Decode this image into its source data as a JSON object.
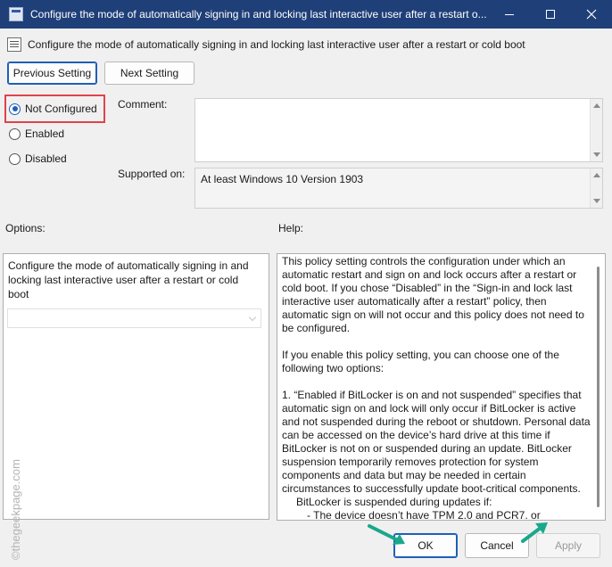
{
  "window": {
    "title": "Configure the mode of automatically signing in and locking last interactive user after a restart o...",
    "controls": [
      "minimize",
      "maximize",
      "close"
    ]
  },
  "policy_title": "Configure the mode of automatically signing in and locking last interactive user after a restart or cold boot",
  "nav": {
    "previous_label": "Previous Setting",
    "next_label": "Next Setting"
  },
  "state": {
    "options": [
      {
        "label": "Not Configured",
        "checked": true
      },
      {
        "label": "Enabled",
        "checked": false
      },
      {
        "label": "Disabled",
        "checked": false
      }
    ]
  },
  "comment": {
    "label": "Comment:",
    "value": ""
  },
  "supported": {
    "label": "Supported on:",
    "value": "At least Windows 10 Version 1903"
  },
  "options_panel": {
    "label": "Options:",
    "description": "Configure the mode of automatically signing in and locking last interactive user after a restart or cold boot",
    "dropdown_value": ""
  },
  "help_panel": {
    "label": "Help:",
    "p1": "This policy setting controls the configuration under which an automatic restart and sign on and lock occurs after a restart or cold boot. If you chose “Disabled” in the “Sign-in and lock last interactive user automatically after a restart” policy, then automatic sign on will not occur and this policy does not need to be configured.",
    "p2": "If you enable this policy setting, you can choose one of the following two options:",
    "p3": "1. “Enabled if BitLocker is on and not suspended” specifies that automatic sign on and lock will only occur if BitLocker is active and not suspended during the reboot or shutdown. Personal data can be accessed on the device’s hard drive at this time if BitLocker is not on or suspended during an update. BitLocker suspension temporarily removes protection for system components and data but may be needed in certain circumstances to successfully update boot-critical components.",
    "p4": "BitLocker is suspended during updates if:",
    "p5": "- The device doesn’t have TPM 2.0 and PCR7, or"
  },
  "footer": {
    "ok_label": "OK",
    "cancel_label": "Cancel",
    "apply_label": "Apply"
  },
  "watermark": "©thegeekpage.com",
  "colors": {
    "titlebar": "#1f3f78",
    "highlight": "#e0434b",
    "arrow": "#1aa88c",
    "accent": "#1f5fb8"
  }
}
